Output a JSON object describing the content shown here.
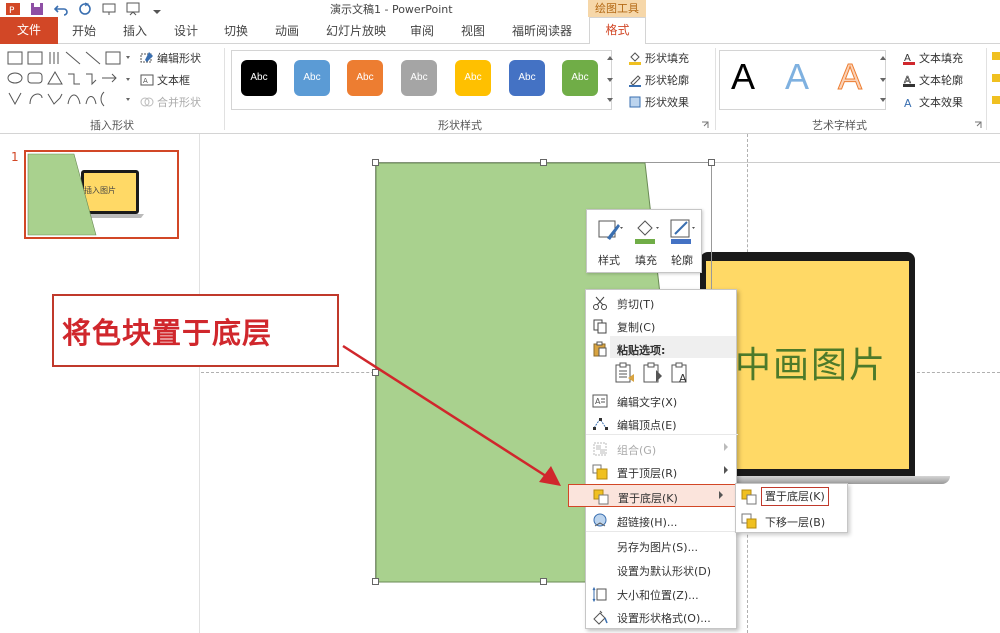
{
  "titlebar": {
    "app_title": "演示文稿1 - PowerPoint",
    "context_tab_group": "绘图工具"
  },
  "tabs": {
    "file": "文件",
    "items": [
      "开始",
      "插入",
      "设计",
      "切换",
      "动画",
      "幻灯片放映",
      "审阅",
      "视图",
      "福昕阅读器"
    ],
    "format": "格式"
  },
  "ribbon": {
    "insert_shapes": {
      "label": "插入形状",
      "edit_shape": "编辑形状",
      "text_box": "文本框",
      "merge_shapes": "合并形状"
    },
    "shape_styles": {
      "label": "形状样式",
      "swatch_text": "Abc",
      "swatch_colors": [
        "#000000",
        "#5b9bd5",
        "#ed7d31",
        "#a5a5a5",
        "#ffc000",
        "#4472c4",
        "#70ad47"
      ],
      "shape_fill": "形状填充",
      "shape_outline": "形状轮廓",
      "shape_effects": "形状效果"
    },
    "wordart": {
      "label": "艺术字样式",
      "letter": "A",
      "text_fill": "文本填充",
      "text_outline": "文本轮廓",
      "text_effects": "文本效果"
    }
  },
  "thumbnail": {
    "slide_number": "1",
    "text": "插入图片"
  },
  "slide": {
    "shape_color": "#a9d18e",
    "laptop_text": "中画图片"
  },
  "callout": {
    "text": "将色块置于底层"
  },
  "minibar": {
    "style": "样式",
    "fill": "填充",
    "outline": "轮廓"
  },
  "context_menu": {
    "cut": "剪切(T)",
    "copy": "复制(C)",
    "paste_options": "粘贴选项:",
    "edit_text": "编辑文字(X)",
    "edit_points": "编辑顶点(E)",
    "group": "组合(G)",
    "bring_to_front": "置于顶层(R)",
    "send_to_back": "置于底层(K)",
    "hyperlink": "超链接(H)...",
    "save_as_picture": "另存为图片(S)...",
    "set_default_shape": "设置为默认形状(D)",
    "size_position": "大小和位置(Z)...",
    "format_shape": "设置形状格式(O)..."
  },
  "submenu": {
    "send_to_back": "置于底层(K)",
    "send_backward": "下移一层(B)"
  },
  "colors": {
    "accent": "#d24726",
    "callout_red": "#d0272c",
    "laptop_screen": "#ffd966"
  }
}
